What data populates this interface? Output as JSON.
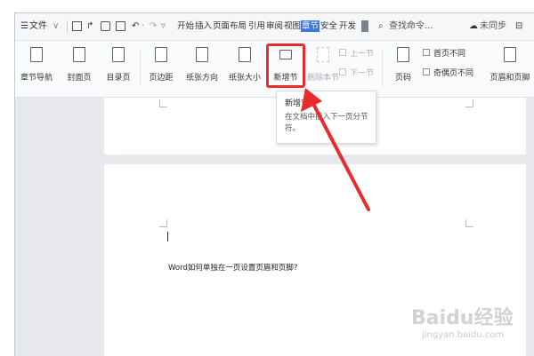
{
  "titlebar": {
    "file_menu": "文件",
    "tabs": [
      "开始",
      "插入",
      "页面布局",
      "引用",
      "审阅",
      "视图",
      "章节",
      "安全",
      "开发"
    ],
    "active_tab": "章节",
    "search": "查找命令...",
    "sync": "未同步"
  },
  "ribbon": {
    "buttons": [
      "章节导航",
      "封面页",
      "目录页",
      "页边距",
      "纸张方向",
      "纸张大小",
      "新增节",
      "删除本节",
      "页码",
      "页眉和页脚"
    ],
    "prev_section": "上一节",
    "next_section": "下一节",
    "checkbox_first_page": "首页不同",
    "checkbox_odd_even": "奇偶页不同"
  },
  "tooltip": {
    "title": "新增节",
    "description": "在文档中插入下一页分节符。"
  },
  "document": {
    "text": "Word如何单独在一页设置页眉和页脚?"
  },
  "watermark": {
    "brand": "Baidu经验",
    "url": "jingyan.baidu.com"
  },
  "colors": {
    "highlight": "#e82b2b",
    "active_tab": "#3c79d8"
  }
}
